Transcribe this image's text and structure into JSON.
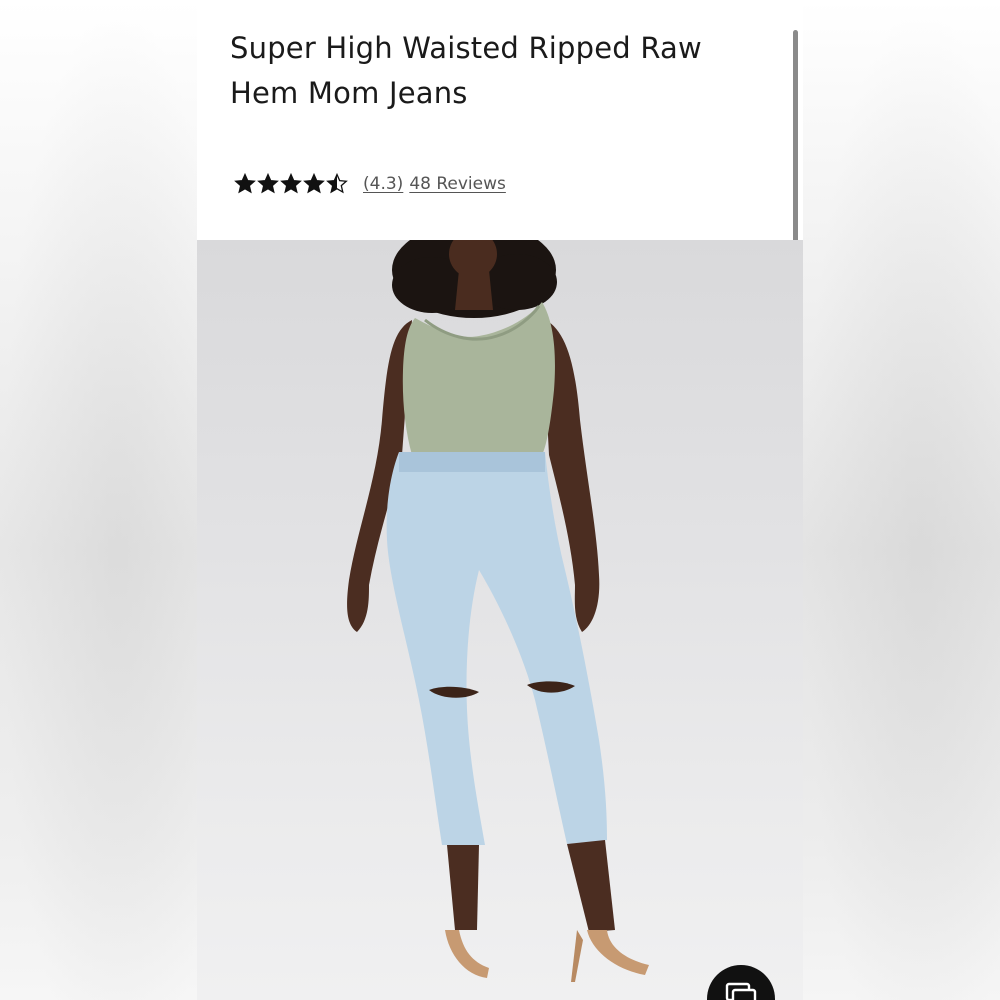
{
  "product": {
    "title": "Super High Waisted Ripped Raw Hem Mom Jeans"
  },
  "rating": {
    "score": 4.3,
    "stars_max": 5,
    "score_label": "(4.3)",
    "reviews_label": "48 Reviews",
    "star_icon": "star-icon",
    "star_color": "#111111"
  },
  "gallery": {
    "image_icon": "model-photo",
    "button_icon": "gallery-icon",
    "button_color": "#111111"
  }
}
